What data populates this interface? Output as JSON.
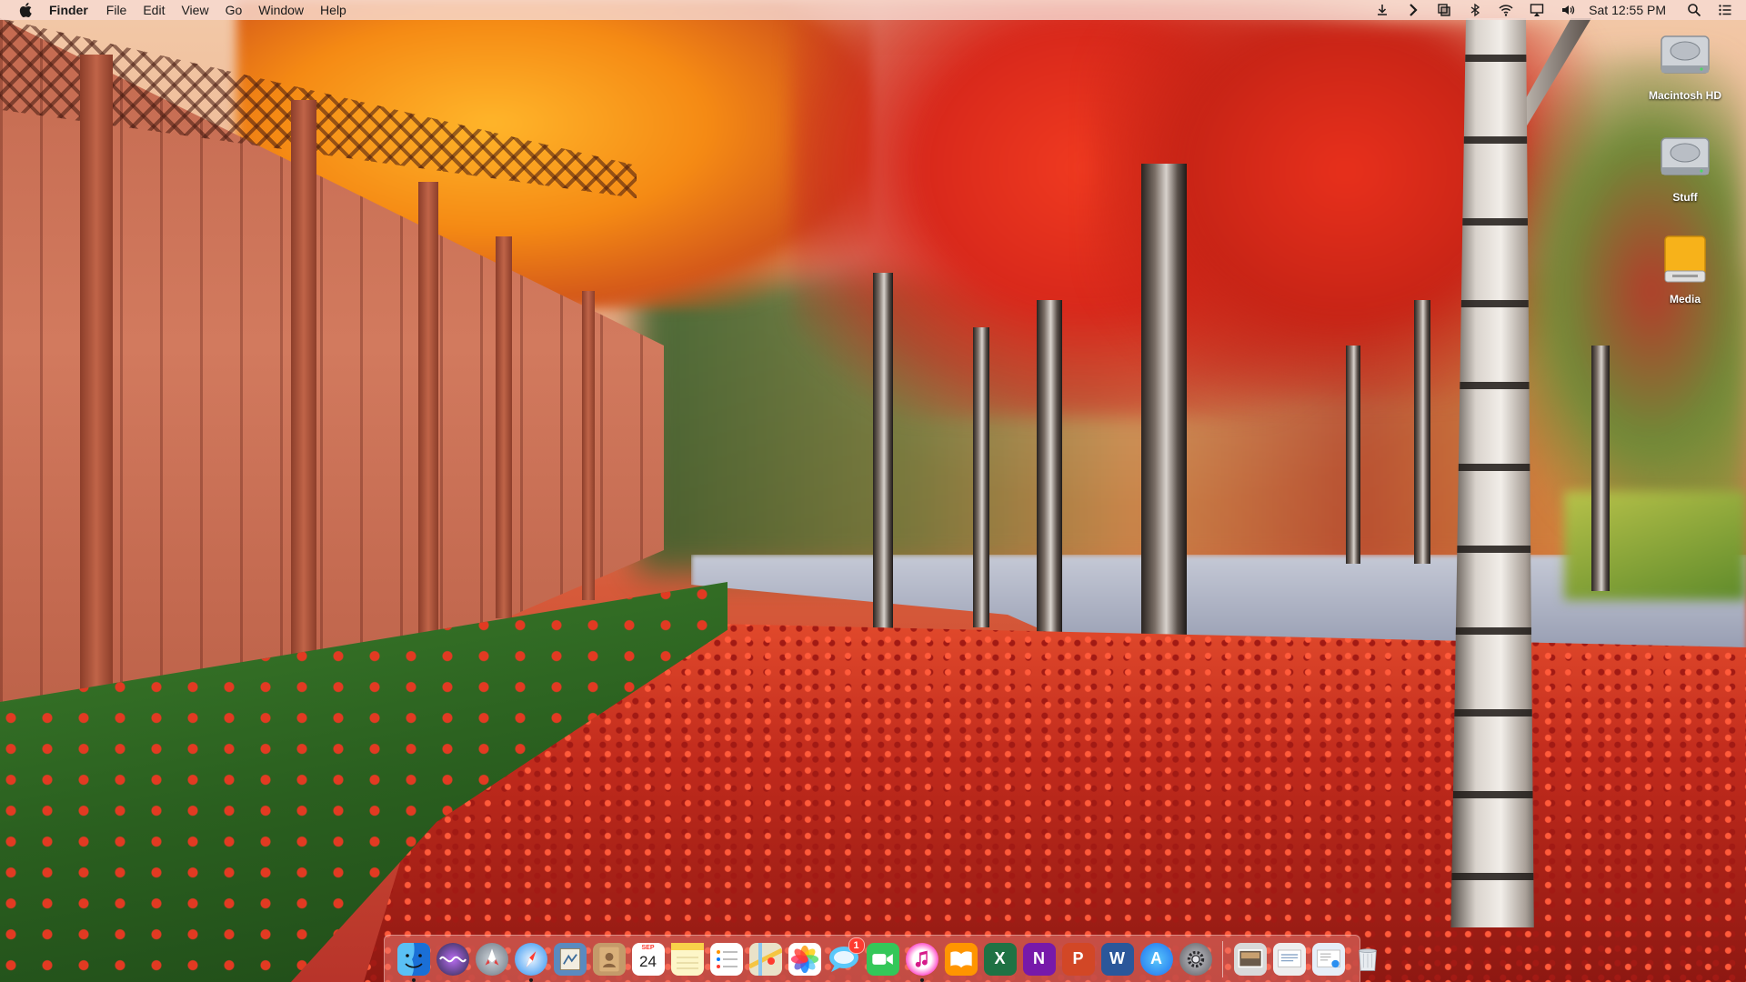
{
  "menubar": {
    "apple_icon": "apple-logo-icon",
    "app_name": "Finder",
    "menus": [
      "File",
      "Edit",
      "View",
      "Go",
      "Window",
      "Help"
    ],
    "status_icons": [
      "download-icon",
      "chevron-right-icon",
      "window-stack-icon",
      "bluetooth-icon",
      "wifi-icon",
      "airplay-icon",
      "volume-icon"
    ],
    "clock": "Sat 12:55 PM",
    "right_icons": [
      "spotlight-search-icon",
      "notification-center-icon"
    ]
  },
  "desktop_icons": [
    {
      "label": "Macintosh HD",
      "icon": "hard-drive-icon"
    },
    {
      "label": "Stuff",
      "icon": "hard-drive-icon"
    },
    {
      "label": "Media",
      "icon": "external-drive-icon"
    }
  ],
  "dock": {
    "apps": [
      {
        "name": "finder",
        "icon": "finder-icon",
        "running": true,
        "color": "#2a8cf0"
      },
      {
        "name": "siri",
        "icon": "siri-icon",
        "running": false,
        "color": "#3a3a5a"
      },
      {
        "name": "launchpad",
        "icon": "launchpad-icon",
        "running": false,
        "color": "#7a8a9a"
      },
      {
        "name": "safari",
        "icon": "safari-icon",
        "running": true,
        "color": "#2b8ff0"
      },
      {
        "name": "preview-mail",
        "icon": "mail-stamp-icon",
        "running": false,
        "color": "#5a8abf"
      },
      {
        "name": "contacts",
        "icon": "contacts-icon",
        "running": false,
        "color": "#c49a6a"
      },
      {
        "name": "calendar",
        "icon": "calendar-icon",
        "running": false,
        "color": "#ffffff",
        "month": "SEP",
        "day": "24"
      },
      {
        "name": "notes",
        "icon": "notes-icon",
        "running": false,
        "color": "#f8e27a"
      },
      {
        "name": "reminders",
        "icon": "reminders-icon",
        "running": false,
        "color": "#ffffff"
      },
      {
        "name": "maps",
        "icon": "maps-icon",
        "running": false,
        "color": "#e9e2c8"
      },
      {
        "name": "photos",
        "icon": "photos-icon",
        "running": false,
        "color": "#ffffff"
      },
      {
        "name": "messages",
        "icon": "messages-icon",
        "running": false,
        "color": "#5ac8fa",
        "badge": "1"
      },
      {
        "name": "facetime",
        "icon": "facetime-icon",
        "running": false,
        "color": "#34c759"
      },
      {
        "name": "itunes",
        "icon": "itunes-icon",
        "running": true,
        "color": "#ff5acd"
      },
      {
        "name": "ibooks",
        "icon": "ibooks-icon",
        "running": false,
        "color": "#ff9500"
      },
      {
        "name": "excel",
        "icon": "excel-icon",
        "running": false,
        "color": "#1f7244",
        "letter": "X"
      },
      {
        "name": "onenote",
        "icon": "onenote-icon",
        "running": false,
        "color": "#7719aa",
        "letter": "N"
      },
      {
        "name": "powerpoint",
        "icon": "powerpoint-icon",
        "running": false,
        "color": "#d24726",
        "letter": "P"
      },
      {
        "name": "word",
        "icon": "word-icon",
        "running": false,
        "color": "#2b579a",
        "letter": "W"
      },
      {
        "name": "app-store",
        "icon": "app-store-icon",
        "running": false,
        "color": "#1e90ff",
        "letter": "A"
      },
      {
        "name": "system-preferences",
        "icon": "gear-icon",
        "running": false,
        "color": "#8e8e93"
      }
    ],
    "stacks": [
      {
        "name": "screenshots-stack",
        "icon": "image-stack-icon",
        "color": "#d9d9d9"
      },
      {
        "name": "documents-stack",
        "icon": "document-stack-icon",
        "color": "#eeeeee"
      },
      {
        "name": "downloads-stack",
        "icon": "download-stack-icon",
        "color": "#e6eef8"
      },
      {
        "name": "trash",
        "icon": "trash-icon",
        "color": "#d8dde3"
      }
    ]
  }
}
